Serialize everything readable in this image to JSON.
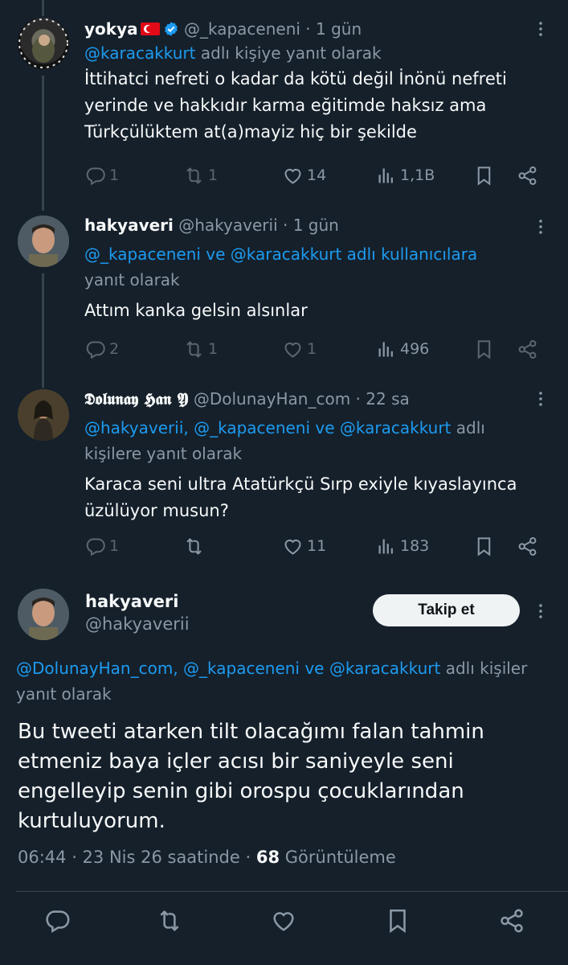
{
  "tweets": [
    {
      "name": "yokya",
      "handle": "@_kapaceneni",
      "time": "· 1 gün",
      "reply_mention": "@karacakkurt",
      "reply_suffix": " adlı kişiye yanıt olarak",
      "text": "İttihatci nefreti o kadar da kötü değil İnönü nefreti yerinde ve hakkıdır karma eğitimde haksız ama Türkçülüktem at(a)mayiz hiç bir şekilde",
      "replies": "1",
      "retweets": "1",
      "likes": "14",
      "views": "1,1B"
    },
    {
      "name": "hakyaveri",
      "handle": "@hakyaverii",
      "time": "· 1 gün",
      "reply_mention": "@_kapaceneni ve @karacakkurt adlı kullanıcılara",
      "reply_suffix": "yanıt olarak",
      "text": "Attım kanka gelsin alsınlar",
      "replies": "2",
      "retweets": "1",
      "likes": "1",
      "views": "496"
    },
    {
      "name": "𝕯𝖔𝖑𝖚𝖓𝖆𝖞 𝕳𝖆𝖓 𝖄",
      "handle": "@DolunayHan_com",
      "time": "· 22 sa",
      "reply_mention": "@hakyaverii, @_kapaceneni ve @karacakkurt",
      "reply_suffix": " adlı kişilere yanıt olarak",
      "text": "Karaca seni ultra Atatürkçü Sırp exiyle kıyaslayınca üzülüyor musun?",
      "replies": "1",
      "retweets": "",
      "likes": "11",
      "views": "183"
    }
  ],
  "main_tweet": {
    "name": "hakyaveri",
    "handle": "@hakyaverii",
    "follow_label": "Takip et",
    "reply_mention": "@DolunayHan_com, @_kapaceneni ve @karacakkurt",
    "reply_suffix": " adlı kişiler",
    "reply_suffix2": "yanıt olarak",
    "text": "Bu tweeti atarken tilt olacağımı falan tahmin etmeniz baya içler acısı bir saniyeyle seni engelleyip senin gibi orospu çocuklarından kurtuluyorum.",
    "time": "06:44 · 23 Nis 26 saatinde · ",
    "views": "68",
    "views_label": " Görüntüleme"
  },
  "icons": {
    "reply": "reply-icon",
    "retweet": "retweet-icon",
    "like": "heart-icon",
    "views": "views-icon",
    "bookmark": "bookmark-icon",
    "share": "share-icon",
    "menu": "more-icon",
    "verified": "verified-badge-icon"
  },
  "colors": {
    "background": "#15202b",
    "mention": "#1d9bf0",
    "muted": "#8b98a5",
    "verified": "#1d9bf0"
  }
}
